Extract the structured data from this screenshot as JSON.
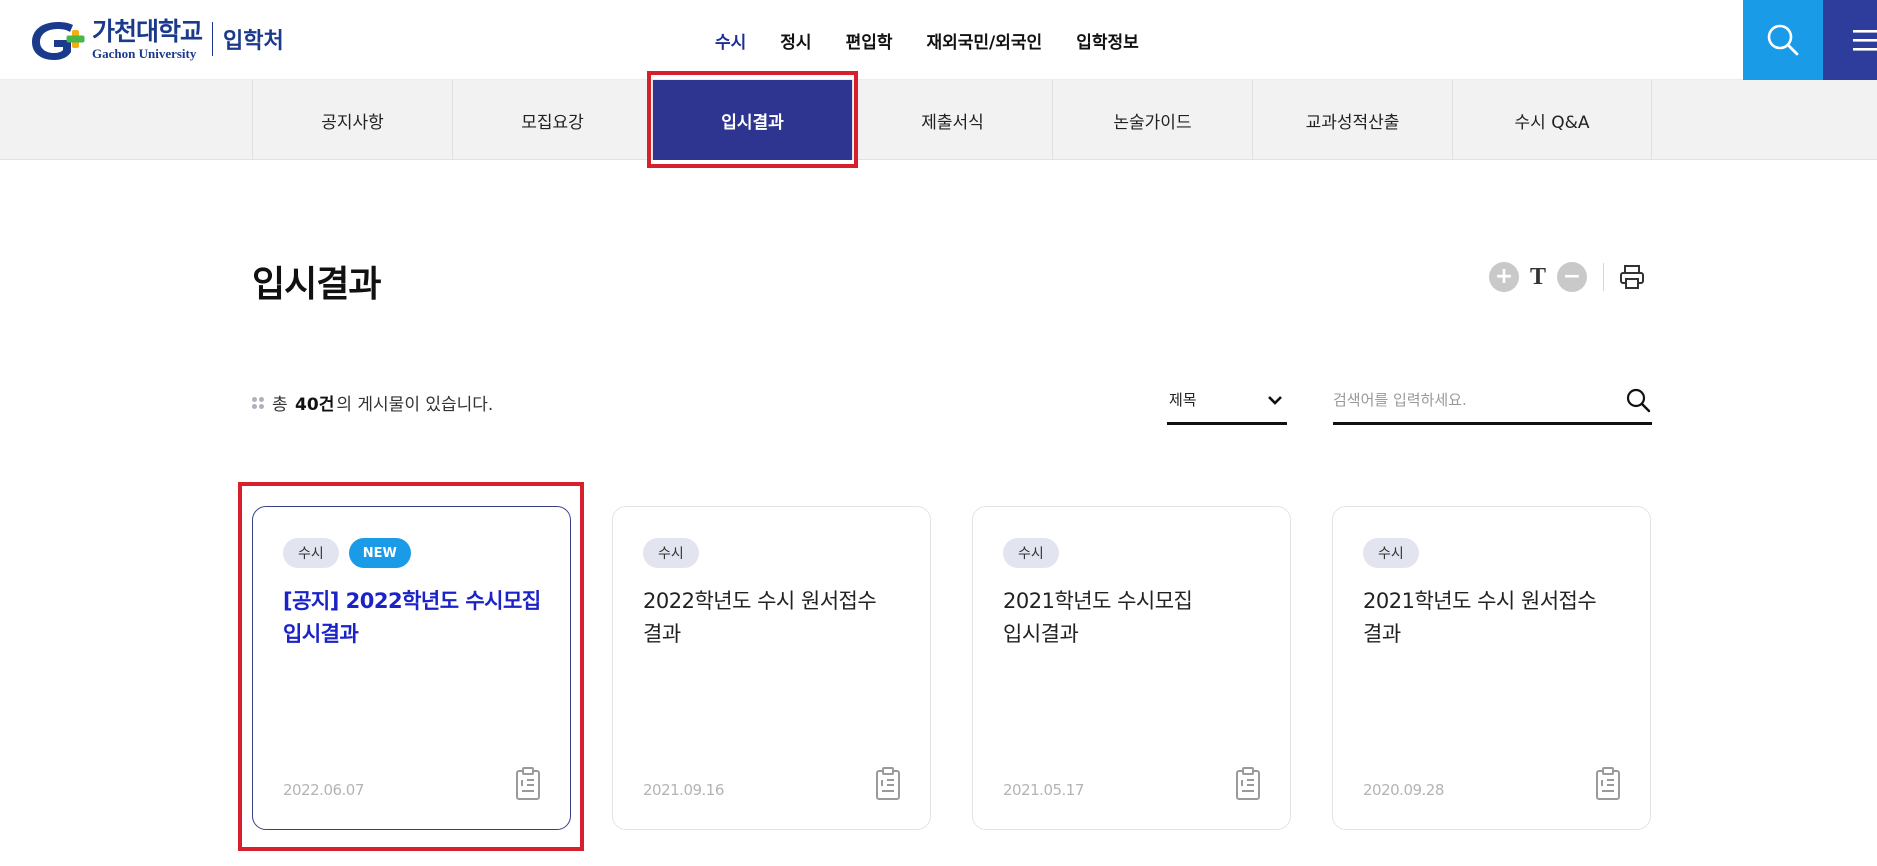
{
  "header": {
    "logo_ko": "가천대학교",
    "logo_en": "Gachon University",
    "logo_sub": "입학처",
    "nav": [
      "수시",
      "정시",
      "편입학",
      "재외국민/외국인",
      "입학정보"
    ],
    "active_nav": "수시",
    "icons": {
      "search": "search-icon",
      "menu": "hamburger-menu-icon"
    },
    "colors": {
      "search_bg": "#1a9be8",
      "menu_bg": "#2e3d9c",
      "brand": "#1b3a8c"
    }
  },
  "subnav": {
    "items": [
      "공지사항",
      "모집요강",
      "입시결과",
      "제출서식",
      "논술가이드",
      "교과성적산출",
      "수시 Q&A"
    ],
    "active": "입시결과",
    "active_color": "#2e3591"
  },
  "page": {
    "title": "입시결과",
    "tools": {
      "zoom_in": "+",
      "text": "T",
      "zoom_out": "−",
      "print": "print-icon"
    }
  },
  "list": {
    "count_prefix": "총",
    "count_value": "40건",
    "count_suffix": "의 게시물이 있습니다.",
    "filter_selected": "제목",
    "search_placeholder": "검색어를 입력하세요."
  },
  "cards": [
    {
      "badges": [
        "수시",
        "NEW"
      ],
      "title": "[공지] 2022학년도 수시모집 입시결과",
      "date": "2022.06.07"
    },
    {
      "badges": [
        "수시"
      ],
      "title": "2022학년도 수시 원서접수 결과",
      "date": "2021.09.16"
    },
    {
      "badges": [
        "수시"
      ],
      "title": "2021학년도 수시모집 입시결과",
      "date": "2021.05.17"
    },
    {
      "badges": [
        "수시"
      ],
      "title": "2021학년도 수시 원서접수 결과",
      "date": "2020.09.28"
    }
  ]
}
